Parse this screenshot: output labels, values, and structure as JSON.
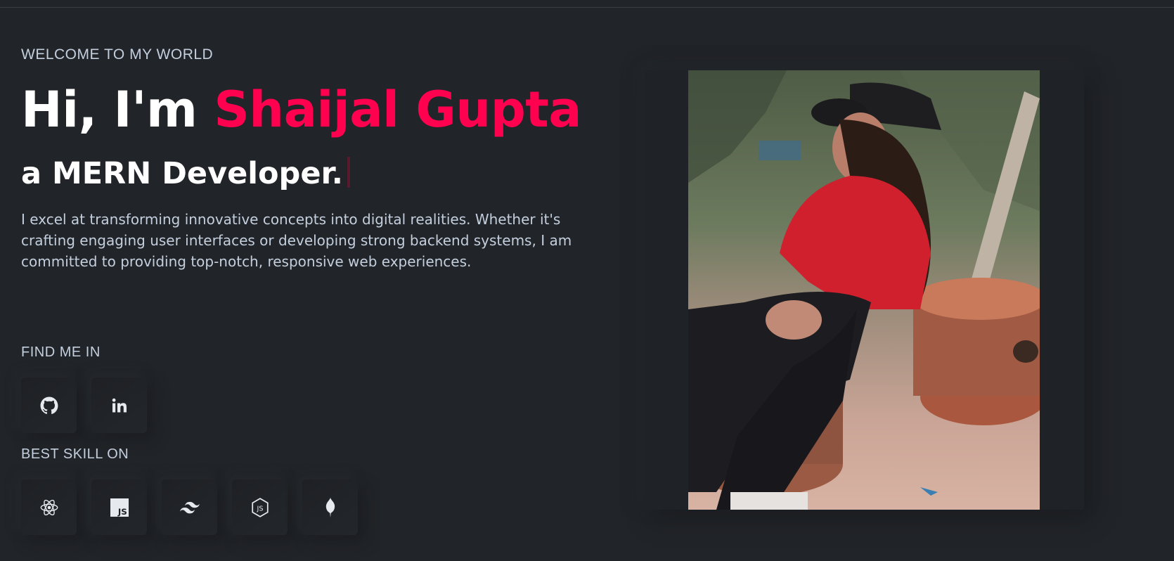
{
  "hero": {
    "eyebrow": "WELCOME TO MY WORLD",
    "greeting": "Hi, I'm ",
    "name": "Shaijal Gupta",
    "role": "a MERN Developer.",
    "bio": "I excel at transforming innovative concepts into digital realities. Whether it's crafting engaging user interfaces or developing strong backend systems, I am committed to providing top-notch, responsive web experiences."
  },
  "social": {
    "label": "FIND ME IN",
    "items": [
      {
        "icon": "github-icon"
      },
      {
        "icon": "linkedin-icon"
      }
    ]
  },
  "skills": {
    "label": "BEST SKILL ON",
    "items": [
      {
        "icon": "react-icon"
      },
      {
        "icon": "javascript-icon"
      },
      {
        "icon": "tailwind-icon"
      },
      {
        "icon": "nodejs-icon"
      },
      {
        "icon": "mongodb-icon"
      }
    ]
  },
  "colors": {
    "background": "#212428",
    "accent": "#ff014f",
    "text": "#c4cfde",
    "heading": "#ffffff"
  }
}
